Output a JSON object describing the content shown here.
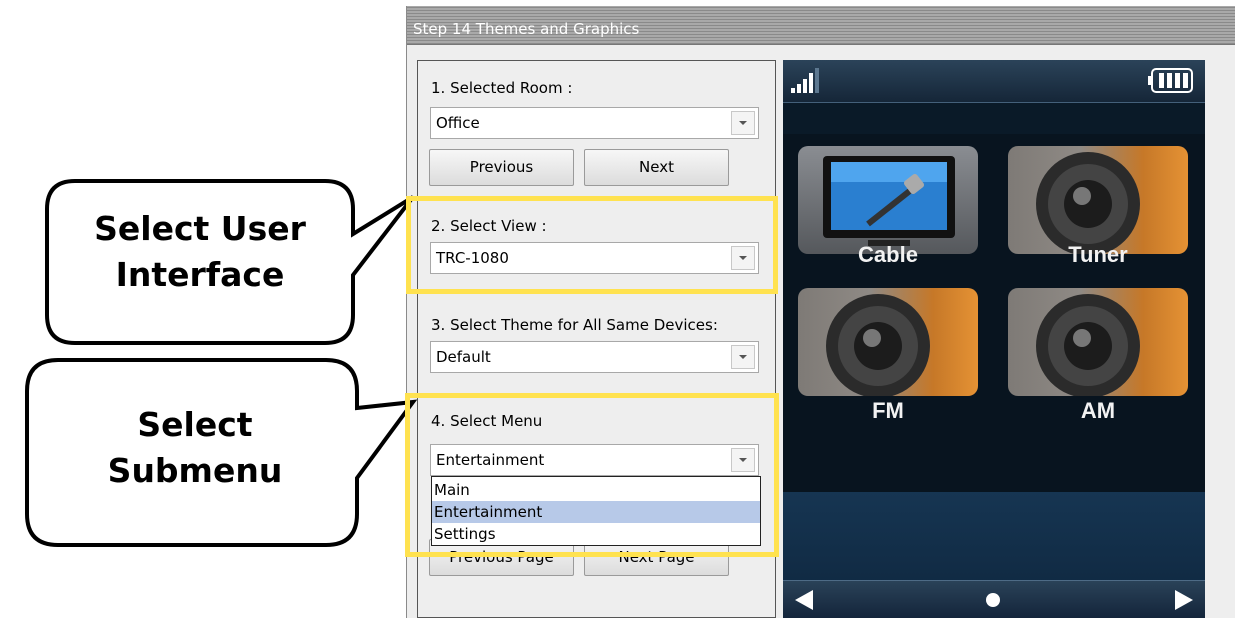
{
  "window": {
    "title": "Step 14 Themes and Graphics"
  },
  "form": {
    "room_label": "1. Selected Room :",
    "room_value": "Office",
    "previous_label": "Previous",
    "next_label": "Next",
    "view_label": "2. Select View :",
    "view_value": "TRC-1080",
    "theme_label": "3. Select Theme for All Same Devices:",
    "theme_value": "Default",
    "menu_label": "4. Select Menu",
    "menu_value": "Entertainment",
    "menu_options": [
      "Main",
      "Entertainment",
      "Settings"
    ],
    "menu_selected_index": 1,
    "previous_page_label": "Previous Page",
    "next_page_label": "Next Page"
  },
  "preview": {
    "tiles": [
      {
        "label": "Cable",
        "icon": "tv-cable-icon"
      },
      {
        "label": "Tuner",
        "icon": "speaker-icon"
      },
      {
        "label": "FM",
        "icon": "speaker-icon"
      },
      {
        "label": "AM",
        "icon": "speaker-icon"
      }
    ],
    "signal_icon": "signal-bars-icon",
    "battery_icon": "battery-icon"
  },
  "callouts": {
    "user_interface": [
      "Select User",
      "Interface"
    ],
    "submenu": [
      "Select",
      "Submenu"
    ]
  },
  "colors": {
    "highlight": "#ffe24f",
    "selected_option": "#b7c9e8",
    "tile_orange": "#e59234",
    "phone_background": "#0a1a28"
  }
}
